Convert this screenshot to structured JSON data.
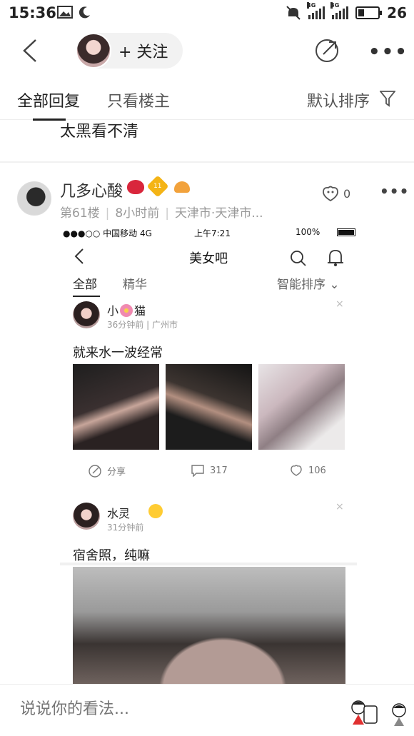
{
  "status_bar": {
    "time": "15:36",
    "network_1": "4G",
    "network_2": "3G",
    "battery": "26"
  },
  "nav": {
    "follow_label": "+ 关注"
  },
  "tabs": {
    "all_replies": "全部回复",
    "owner_only": "只看楼主",
    "sort": "默认排序"
  },
  "previous_reply_text": "太黑看不清",
  "reply": {
    "author": "几多心酸",
    "level_badge": "11",
    "floor": "第61楼",
    "time_ago": "8小时前",
    "location": "天津市·天津市...",
    "like_count": "0"
  },
  "embedded": {
    "carrier": "●●●○○ 中国移动  4G",
    "clock": "上午7:21",
    "battery_pct": "100%",
    "title": "美女吧",
    "tab_all": "全部",
    "tab_featured": "精华",
    "sort": "智能排序 ⌄",
    "post1": {
      "author_prefix": "小",
      "author_suffix": "猫",
      "meta": "36分钟前  |  广州市",
      "text": "就来水一波经常",
      "share": "分享",
      "comments": "317",
      "likes": "106",
      "close": "×"
    },
    "post2": {
      "author": "水灵",
      "meta": "31分钟前",
      "text": "宿舍照，纯嘛",
      "close": "×"
    }
  },
  "comment_box": {
    "placeholder": "说说你的看法..."
  }
}
